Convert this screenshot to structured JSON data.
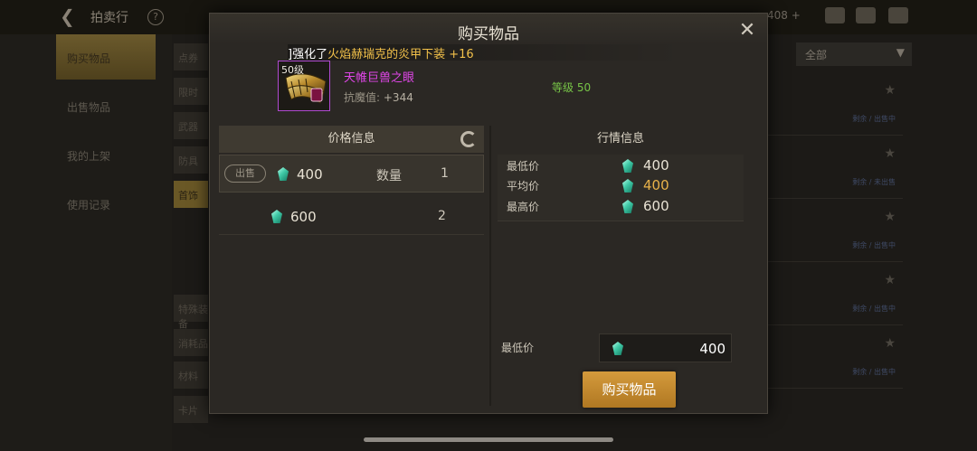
{
  "background": {
    "title": "拍卖行",
    "help": "?",
    "currency": "408 +",
    "sidebar": [
      "购买物品",
      "出售物品",
      "我的上架",
      "使用记录"
    ],
    "categories": [
      "点券",
      "限时",
      "武器",
      "防具",
      "首饰",
      "特殊装备",
      "消耗品",
      "材料",
      "卡片"
    ],
    "filter": "全部",
    "row_meta": [
      "剩余 / 出售中",
      "剩余 / 未出售",
      "剩余 / 出售中",
      "剩余 / 出售中",
      "剩余 / 出售中",
      "剩余 / 出售中"
    ]
  },
  "modal": {
    "title": "购买物品",
    "close": "✕",
    "notice": {
      "prefix": "]强化了",
      "highlight": "火焰赫瑞克的炎甲下装 +16"
    },
    "item": {
      "level_badge": "50级",
      "name": "天帷巨兽之眼",
      "stat_label": "抗魔值:",
      "stat_value": "+344",
      "level_text": "等级 50",
      "border_color": "#b04ad1",
      "name_color": "#e046e8"
    },
    "price_info": {
      "header": "价格信息",
      "sell_label": "出售",
      "quantity_label": "数量",
      "rows": [
        {
          "price": "400",
          "quantity": "1"
        },
        {
          "price": "600",
          "quantity": "2"
        }
      ]
    },
    "market_info": {
      "header": "行情信息",
      "rows": [
        {
          "label": "最低价",
          "value": "400"
        },
        {
          "label": "平均价",
          "value": "400"
        },
        {
          "label": "最高价",
          "value": "600"
        }
      ]
    },
    "min_price": {
      "label": "最低价",
      "value": "400"
    },
    "buy_button": "购买物品",
    "accent_color": "#c48a30"
  }
}
